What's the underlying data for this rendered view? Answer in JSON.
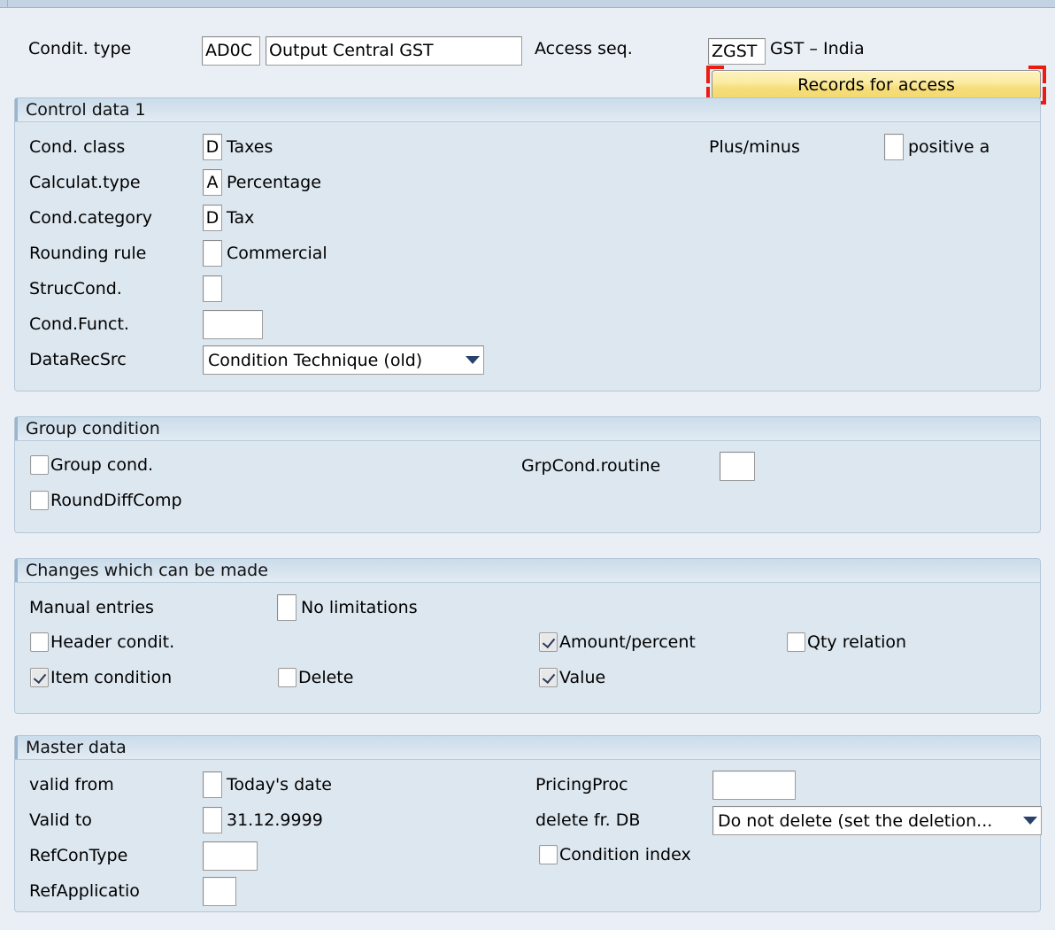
{
  "header": {
    "condition_type_label": "Condit. type",
    "condition_type_key": "AD0C",
    "condition_type_desc": "Output Central GST",
    "access_seq_label": "Access seq.",
    "access_seq_key": "ZGST",
    "access_seq_desc": "GST – India",
    "records_button": "Records for access"
  },
  "control_data": {
    "title": "Control data 1",
    "cond_class_label": "Cond. class",
    "cond_class_key": "D",
    "cond_class_text": "Taxes",
    "calc_type_label": "Calculat.type",
    "calc_type_key": "A",
    "calc_type_text": "Percentage",
    "cond_category_label": "Cond.category",
    "cond_category_key": "D",
    "cond_category_text": "Tax",
    "rounding_rule_label": "Rounding rule",
    "rounding_rule_key": "",
    "rounding_rule_text": "Commercial",
    "struc_cond_label": "StrucCond.",
    "struc_cond_key": "",
    "cond_funct_label": "Cond.Funct.",
    "cond_funct_value": "",
    "data_rec_src_label": "DataRecSrc",
    "data_rec_src_value": "Condition Technique (old)",
    "plus_minus_label": "Plus/minus",
    "plus_minus_key": "",
    "plus_minus_text": "positive a"
  },
  "group_condition": {
    "title": "Group condition",
    "group_cond_label": "Group cond.",
    "group_cond_checked": false,
    "round_diff_label": "RoundDiffComp",
    "round_diff_checked": false,
    "grp_routine_label": "GrpCond.routine",
    "grp_routine_value": ""
  },
  "changes": {
    "title": "Changes which can be made",
    "manual_entries_label": "Manual entries",
    "manual_entries_key": "",
    "manual_entries_text": "No limitations",
    "header_condit_label": "Header condit.",
    "header_condit_checked": false,
    "item_condition_label": "Item condition",
    "item_condition_checked": true,
    "delete_label": "Delete",
    "delete_checked": false,
    "amount_percent_label": "Amount/percent",
    "amount_percent_checked": true,
    "value_label": "Value",
    "value_checked": true,
    "qty_relation_label": "Qty relation",
    "qty_relation_checked": false
  },
  "master_data": {
    "title": "Master data",
    "valid_from_label": "valid from",
    "valid_from_key": "",
    "valid_from_text": "Today's date",
    "valid_to_label": "Valid to",
    "valid_to_key": "",
    "valid_to_text": "31.12.9999",
    "ref_con_type_label": "RefConType",
    "ref_con_type_value": "",
    "ref_application_label": "RefApplicatio",
    "ref_application_value": "",
    "pricing_proc_label": "PricingProc",
    "pricing_proc_value": "",
    "delete_fr_db_label": "delete fr. DB",
    "delete_fr_db_value": "Do not delete (set the deletion...",
    "condition_index_label": "Condition index",
    "condition_index_checked": false
  },
  "colors": {
    "page_background": "#eaeff5",
    "panel_background": "#dde7f0",
    "panel_header": "#cadcea",
    "button_yellow": "#f6dd79",
    "selection_red": "#ee1b11",
    "arrow_navy": "#28426b"
  }
}
